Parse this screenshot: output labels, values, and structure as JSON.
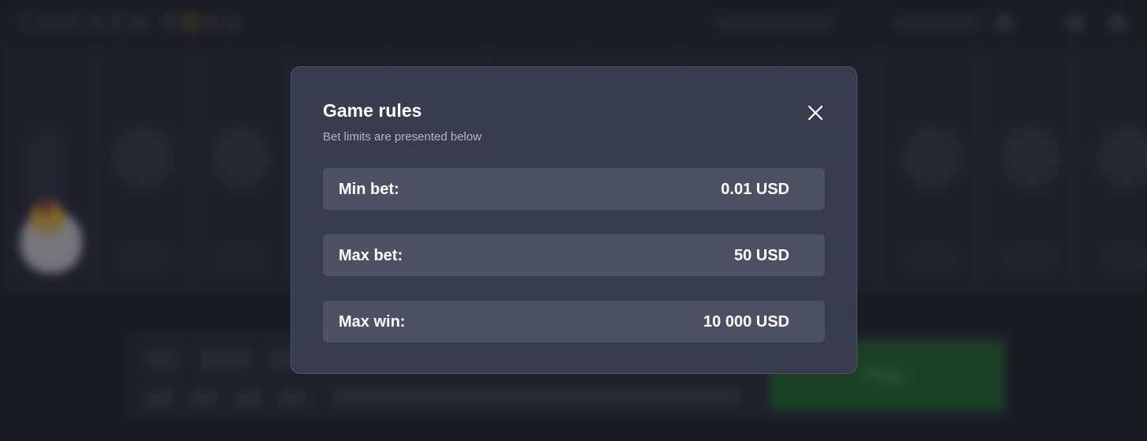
{
  "background": {
    "logo_text": "CHICKEN ROAD",
    "play_label": "Play"
  },
  "modal": {
    "title": "Game rules",
    "subtitle": "Bet limits are presented below",
    "close_icon": "close-icon",
    "rows": [
      {
        "label": "Min bet:",
        "value": "0.01 USD"
      },
      {
        "label": "Max bet:",
        "value": "50 USD"
      },
      {
        "label": "Max win:",
        "value": "10 000 USD"
      }
    ]
  },
  "colors": {
    "modal_bg": "#393b4e",
    "row_bg": "#4e5063",
    "page_bg": "#1c1d26",
    "play_green": "#1e5a2a"
  }
}
